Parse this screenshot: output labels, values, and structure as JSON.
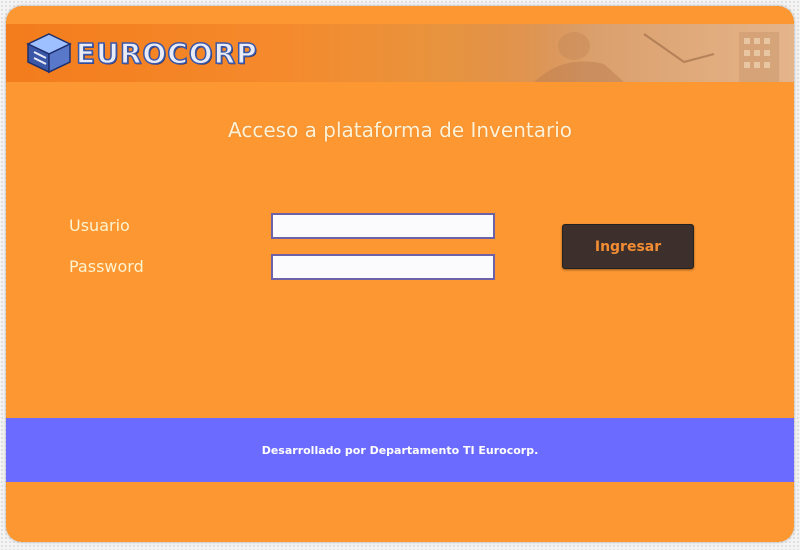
{
  "brand": {
    "name": "EUROCORP",
    "logo_icon": "cube-stack-icon"
  },
  "login": {
    "title": "Acceso a plataforma de Inventario",
    "user_label": "Usuario",
    "user_value": "",
    "password_label": "Password",
    "password_value": "",
    "submit_label": "Ingresar"
  },
  "footer": {
    "text": "Desarrollado por Departamento TI Eurocorp."
  },
  "colors": {
    "panel": "#fc9732",
    "header": "#f37c1c",
    "footer_band": "#6b6bff",
    "button": "#3d2f2b",
    "button_text": "#f38d33"
  }
}
